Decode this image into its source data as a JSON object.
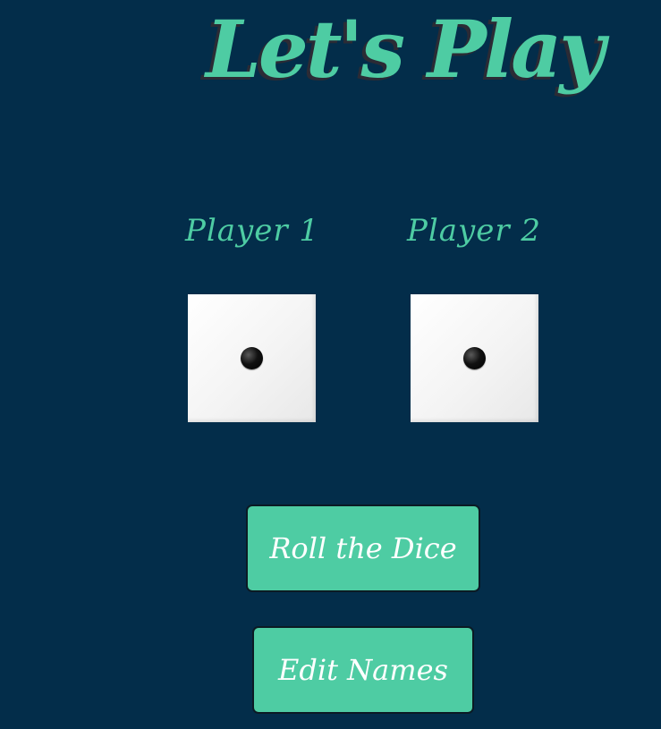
{
  "title": "Let's Play",
  "players": [
    {
      "name": "Player 1",
      "die_value": 1
    },
    {
      "name": "Player 2",
      "die_value": 1
    }
  ],
  "buttons": {
    "roll_label": "Roll the Dice",
    "edit_label": "Edit Names"
  },
  "colors": {
    "background": "#032d4a",
    "accent": "#4ecca3",
    "button_text": "#ffffff"
  }
}
